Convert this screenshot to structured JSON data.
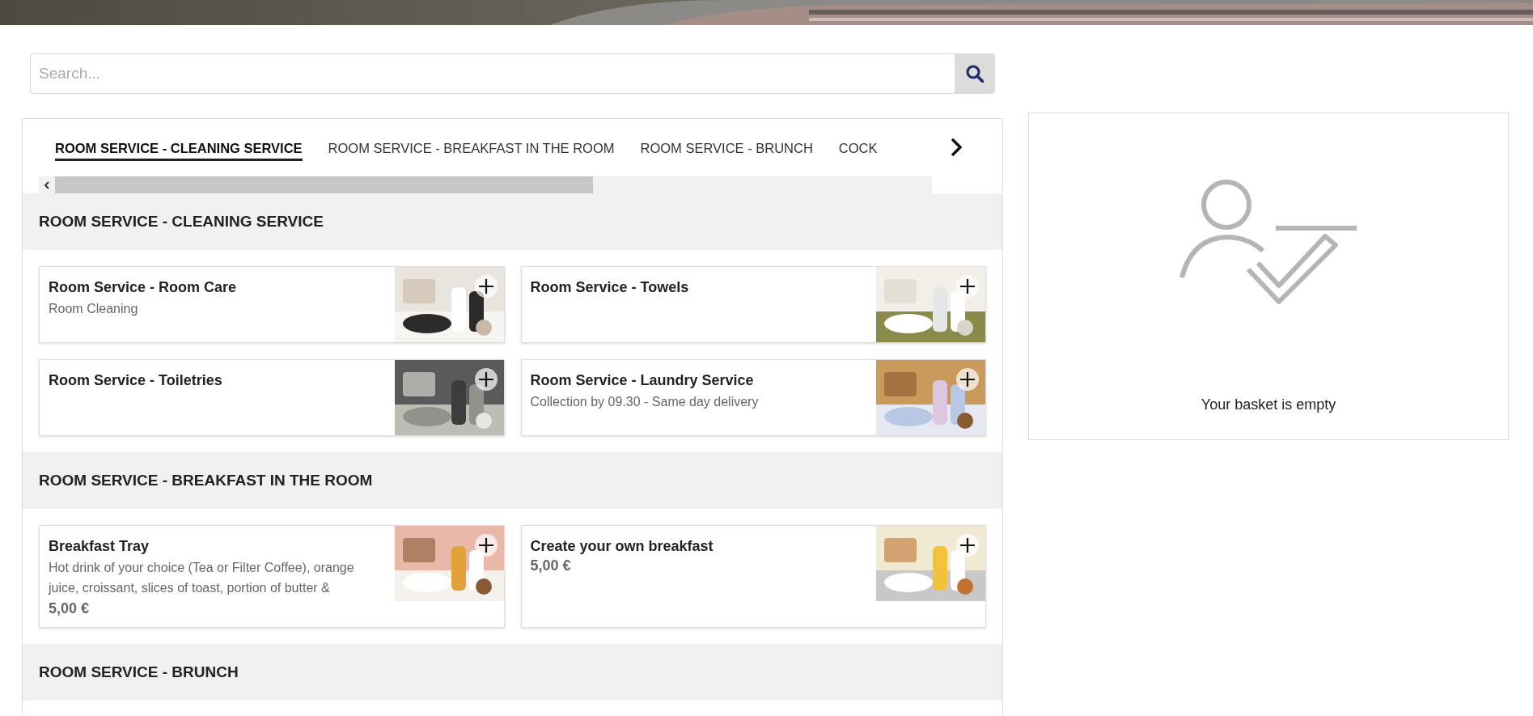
{
  "search": {
    "placeholder": "Search..."
  },
  "tabs": [
    {
      "label": "ROOM SERVICE - CLEANING SERVICE",
      "selected": true
    },
    {
      "label": "ROOM SERVICE - BREAKFAST IN THE ROOM",
      "selected": false
    },
    {
      "label": "ROOM SERVICE - BRUNCH",
      "selected": false
    },
    {
      "label": "COCK",
      "selected": false
    }
  ],
  "sections": [
    {
      "title": "ROOM SERVICE - CLEANING SERVICE",
      "items": [
        {
          "name": "Room Service - Room Care",
          "description": "Room Cleaning"
        },
        {
          "name": "Room Service - Towels"
        },
        {
          "name": "Room Service - Toiletries"
        },
        {
          "name": "Room Service - Laundry Service",
          "description": "Collection by 09.30 - Same day delivery"
        }
      ]
    },
    {
      "title": "ROOM SERVICE - BREAKFAST IN THE ROOM",
      "items": [
        {
          "name": "Breakfast Tray",
          "description": "Hot drink of your choice (Tea or Filter Coffee), orange juice, croissant, slices of toast, portion of butter &",
          "price": "5,00 €"
        },
        {
          "name": "Create your own breakfast",
          "price": "5,00 €"
        }
      ]
    },
    {
      "title": "ROOM SERVICE - BRUNCH"
    }
  ],
  "basket": {
    "empty_message": "Your basket is empty"
  }
}
